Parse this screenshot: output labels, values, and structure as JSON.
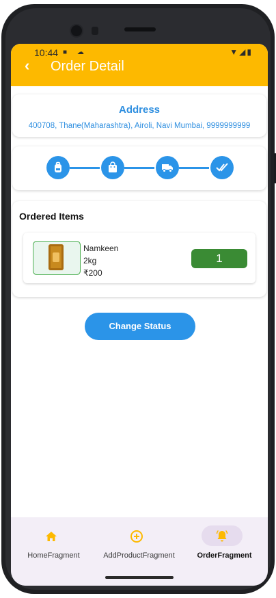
{
  "status_bar": {
    "time": "10:44",
    "left_icons": "■ ☁",
    "right_icons": "▼◢▮"
  },
  "appbar": {
    "back_icon": "arrow-back-icon",
    "title": "Order Detail",
    "color": "#fdb900"
  },
  "address": {
    "title": "Address",
    "text": "400708, Thane(Maharashtra), Airoli, Navi Mumbai, 9999999999"
  },
  "tracking": {
    "steps": [
      "backpack-icon",
      "shopping-bag-icon",
      "truck-icon",
      "done-all-icon"
    ],
    "color": "#2b94e8"
  },
  "ordered_items": {
    "title": "Ordered Items",
    "items": [
      {
        "name": "Namkeen",
        "weight": "2kg",
        "price": "₹200",
        "quantity": "1"
      }
    ]
  },
  "actions": {
    "change_status_label": "Change Status"
  },
  "bottom_nav": {
    "items": [
      {
        "label": "HomeFragment",
        "icon": "home-icon",
        "active": false
      },
      {
        "label": "AddProductFragment",
        "icon": "add-circle-icon",
        "active": false
      },
      {
        "label": "OrderFragment",
        "icon": "bell-ring-icon",
        "active": true
      }
    ],
    "icon_color": "#fdb900"
  }
}
